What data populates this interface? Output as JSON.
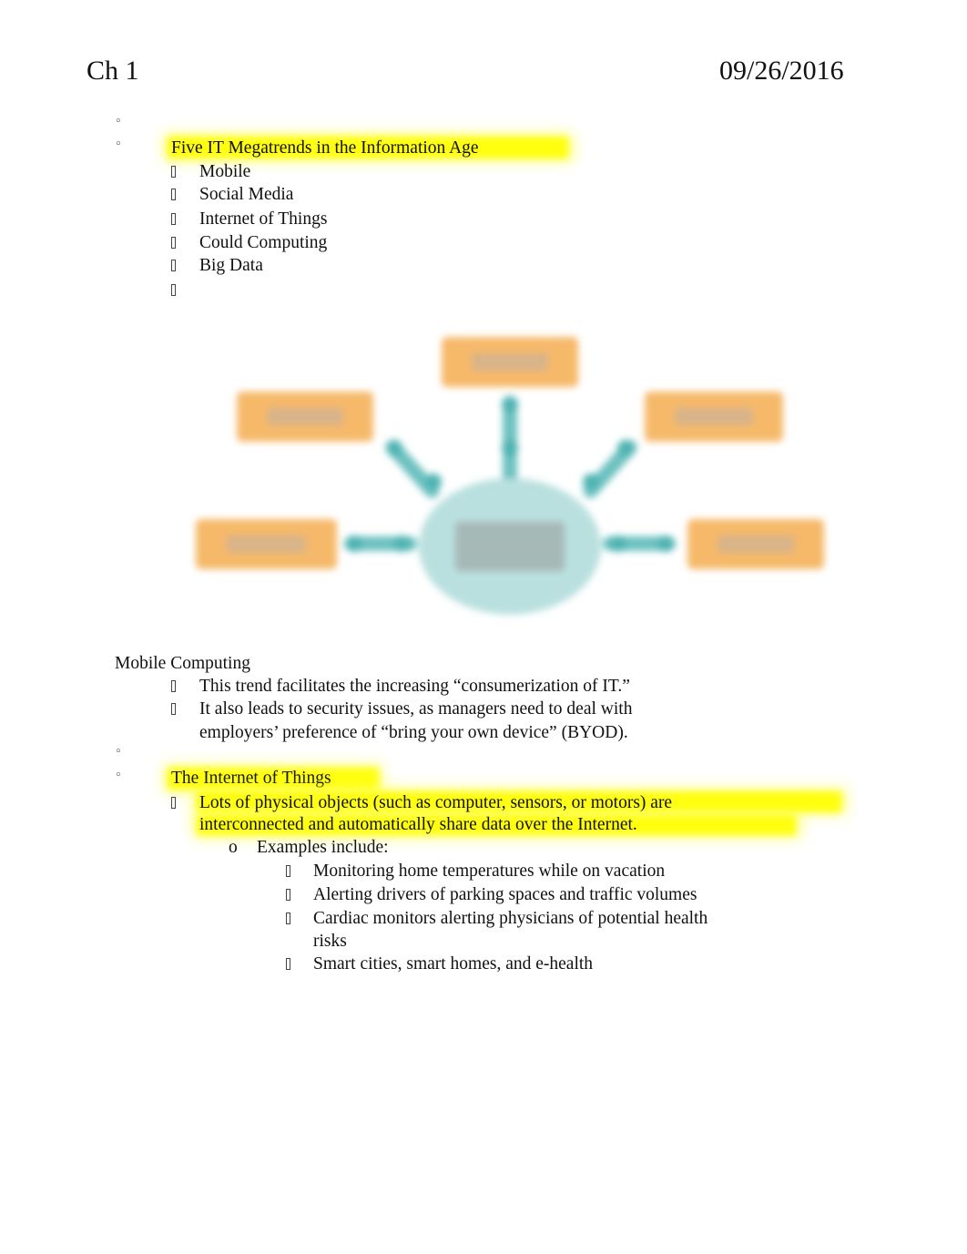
{
  "header": {
    "title": "Ch 1",
    "date": "09/26/2016"
  },
  "section1": {
    "empty_bullet": "",
    "heading": "Five IT Megatrends in the Information Age",
    "items": [
      "Mobile",
      "Social Media",
      "Internet of Things",
      "Could Computing",
      "Big Data",
      ""
    ]
  },
  "diagram": {
    "description": "Blurred hub-and-spoke diagram: central circle connected by arrows to five surrounding boxes (labels illegible)",
    "colors": {
      "box": "#f6b96a",
      "hub": "#b9e0df",
      "arrow": "#6cc1c0"
    }
  },
  "section2": {
    "heading": "Mobile Computing",
    "items": [
      "This trend facilitates the increasing “consumerization of IT.”",
      "It also leads to security issues, as managers need to deal with",
      "employers’ preference of “bring your own device” (BYOD)."
    ]
  },
  "section3": {
    "empty_bullet": "",
    "heading": "The Internet of Things",
    "item_line1": "Lots of physical objects (such as computer, sensors, or motors) are",
    "item_line2": "interconnected and automatically share data over the Internet.",
    "sub_marker": "o",
    "sub_heading": "Examples include:",
    "examples": [
      "Monitoring home temperatures while on vacation",
      "Alerting drivers of parking spaces and traffic volumes",
      "Cardiac monitors alerting physicians of potential health",
      "risks",
      "Smart cities, smart homes, and e-health"
    ]
  },
  "colors": {
    "highlight": "#ffff00",
    "text": "#111111"
  }
}
